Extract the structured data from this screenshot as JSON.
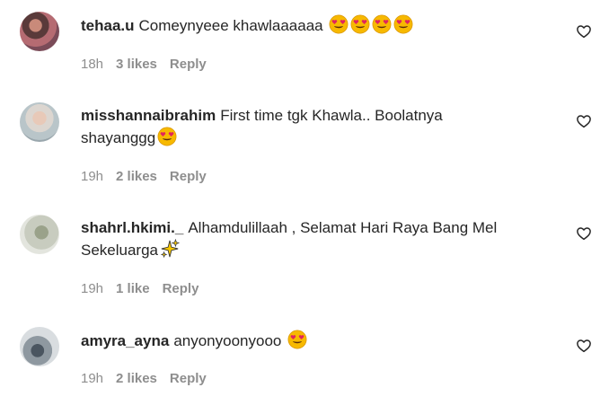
{
  "comments": [
    {
      "username": "tehaa.u",
      "text": "Comeynyeee khawlaaaaaa",
      "emojis": [
        "heart-eyes-emoji",
        "heart-eyes-emoji",
        "heart-eyes-emoji",
        "heart-eyes-emoji"
      ],
      "time": "18h",
      "likes": "3 likes",
      "reply": "Reply"
    },
    {
      "username": "misshannaibrahim",
      "text": "First time tgk Khawla.. Boolatnya shayanggg",
      "emojis": [
        "heart-eyes-emoji"
      ],
      "time": "19h",
      "likes": "2 likes",
      "reply": "Reply"
    },
    {
      "username": "shahrl.hkimi._",
      "text": "Alhamdulillaah , Selamat Hari Raya Bang Mel Sekeluarga",
      "emojis": [
        "sparkles-emoji"
      ],
      "time": "19h",
      "likes": "1 like",
      "reply": "Reply"
    },
    {
      "username": "amyra_ayna",
      "text": "anyonyoonyooo",
      "emojis": [
        "heart-eyes-emoji"
      ],
      "time": "19h",
      "likes": "2 likes",
      "reply": "Reply"
    }
  ],
  "colors": {
    "text": "#262626",
    "meta": "#8e8e8e",
    "emoji_face": "#f7b900",
    "emoji_heart": "#e0245e"
  }
}
